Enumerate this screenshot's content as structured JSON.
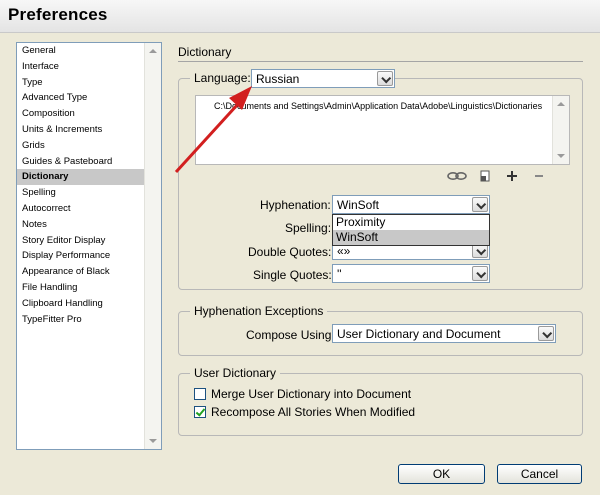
{
  "window": {
    "title": "Preferences"
  },
  "categories": [
    "General",
    "Interface",
    "Type",
    "Advanced Type",
    "Composition",
    "Units & Increments",
    "Grids",
    "Guides & Pasteboard",
    "Dictionary",
    "Spelling",
    "Autocorrect",
    "Notes",
    "Story Editor Display",
    "Display Performance",
    "Appearance of Black",
    "File Handling",
    "Clipboard Handling",
    "TypeFitter Pro"
  ],
  "selected_category": "Dictionary",
  "dictionary": {
    "section_title": "Dictionary",
    "language_label": "Language:",
    "language_value": "Russian",
    "path": "C:\\Documents and Settings\\Admin\\Application Data\\Adobe\\Linguistics\\Dictionaries",
    "hyphenation_label": "Hyphenation:",
    "hyphenation_value": "WinSoft",
    "hyphenation_options": [
      "Proximity",
      "WinSoft"
    ],
    "spelling_label": "Spelling:",
    "double_quotes_label": "Double Quotes:",
    "double_quotes_value": "«»",
    "single_quotes_label": "Single Quotes:",
    "single_quotes_value": "''"
  },
  "hyphenation_exceptions": {
    "legend": "Hyphenation Exceptions",
    "compose_label": "Compose Using:",
    "compose_value": "User Dictionary and Document"
  },
  "user_dictionary": {
    "legend": "User Dictionary",
    "merge_label": "Merge User Dictionary into Document",
    "merge_checked": false,
    "recompose_label": "Recompose All Stories When Modified",
    "recompose_checked": true
  },
  "buttons": {
    "ok": "OK",
    "cancel": "Cancel"
  },
  "colors": {
    "annotation_arrow": "#d21f1f",
    "selection": "#c8c8c8",
    "check": "#21a121"
  },
  "icons": [
    "link-icon",
    "new-dictionary-icon",
    "add-icon",
    "remove-icon"
  ]
}
